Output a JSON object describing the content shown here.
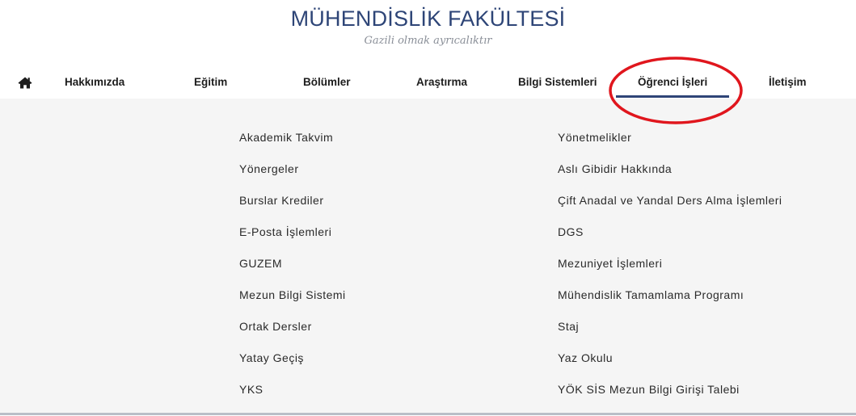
{
  "header": {
    "title": "MÜHENDİSLİK FAKÜLTESİ",
    "slogan": "Gazili olmak ayrıcalıktır"
  },
  "nav": {
    "home_icon": "home-icon",
    "items": [
      {
        "label": "Hakkımızda"
      },
      {
        "label": "Eğitim"
      },
      {
        "label": "Bölümler"
      },
      {
        "label": "Araştırma"
      },
      {
        "label": "Bilgi Sistemleri"
      },
      {
        "label": "Öğrenci İşleri",
        "active": true
      },
      {
        "label": "İletişim"
      }
    ]
  },
  "dropdown": {
    "left_column": [
      "Akademik Takvim",
      "Yönergeler",
      "Burslar Krediler",
      "E-Posta İşlemleri",
      "GUZEM",
      "Mezun Bilgi Sistemi",
      "Ortak Dersler",
      "Yatay Geçiş",
      "YKS"
    ],
    "right_column": [
      "Yönetmelikler",
      "Aslı Gibidir Hakkında",
      "Çift Anadal ve Yandal Ders Alma İşlemleri",
      "DGS",
      "Mezuniyet İşlemleri",
      "Mühendislik Tamamlama Programı",
      "Staj",
      "Yaz Okulu",
      "YÖK SİS Mezun Bilgi Girişi Talebi"
    ]
  },
  "colors": {
    "brand": "#2e4577",
    "annotation": "#e0161d",
    "dropdown_bg": "#f5f5f5"
  }
}
